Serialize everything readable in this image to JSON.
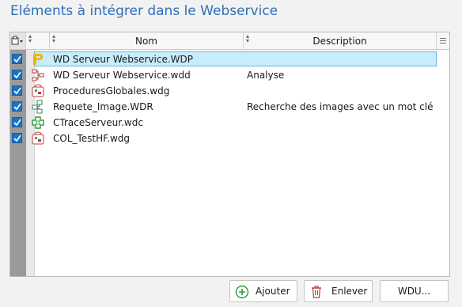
{
  "title": "Eléments à intégrer dans le Webservice",
  "table": {
    "columns": {
      "name": "Nom",
      "description": "Description"
    },
    "rows": [
      {
        "checked": true,
        "icon": "project-p-icon",
        "name": "WD Serveur Webservice.WDP",
        "description": "",
        "selected": true
      },
      {
        "checked": true,
        "icon": "analysis-icon",
        "name": "WD Serveur Webservice.wdd",
        "description": "Analyse",
        "selected": false
      },
      {
        "checked": true,
        "icon": "procedures-set-icon",
        "name": "ProceduresGlobales.wdg",
        "description": "",
        "selected": false
      },
      {
        "checked": true,
        "icon": "query-icon",
        "name": "Requete_Image.WDR",
        "description": "Recherche des images avec un mot clé",
        "selected": false
      },
      {
        "checked": true,
        "icon": "class-icon",
        "name": "CTraceServeur.wdc",
        "description": "",
        "selected": false
      },
      {
        "checked": true,
        "icon": "procedures-set-icon",
        "name": "COL_TestHF.wdg",
        "description": "",
        "selected": false
      }
    ]
  },
  "buttons": {
    "add": "Ajouter",
    "remove": "Enlever",
    "wdu": "WDU..."
  },
  "colors": {
    "title": "#2f6fb6",
    "checkbox": "#1c72c4",
    "selection": "#c8ecfb",
    "gutter": "#9a9a9a"
  }
}
